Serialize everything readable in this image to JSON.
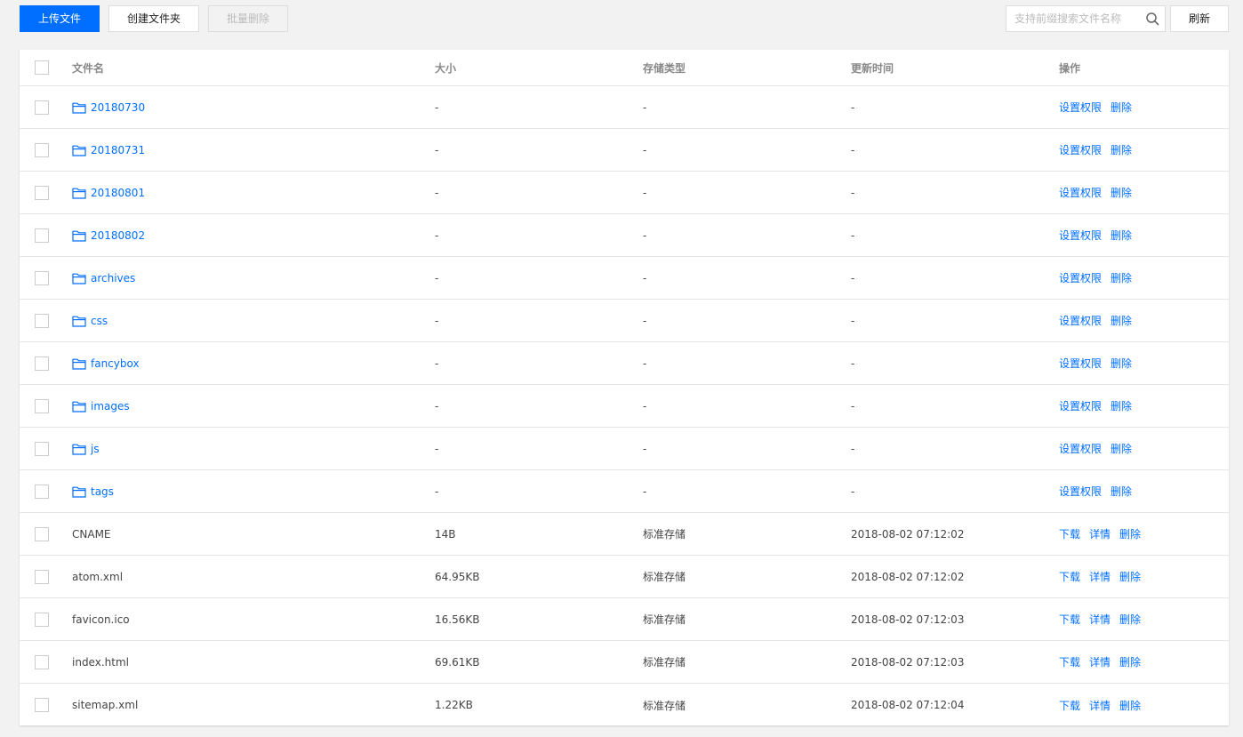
{
  "toolbar": {
    "upload_label": "上传文件",
    "mkdir_label": "创建文件夹",
    "batch_delete_label": "批量删除",
    "refresh_label": "刷新",
    "search_placeholder": "支持前缀搜索文件名称"
  },
  "colors": {
    "accent": "#006eff",
    "background": "#f2f2f2",
    "panel": "#ffffff"
  },
  "table": {
    "columns": {
      "name": "文件名",
      "size": "大小",
      "storage": "存储类型",
      "updated": "更新时间",
      "actions": "操作"
    },
    "folder_actions": [
      "设置权限",
      "删除"
    ],
    "file_actions": [
      "下载",
      "详情",
      "删除"
    ],
    "rows": [
      {
        "type": "folder",
        "name": "20180730",
        "size": "-",
        "storage": "-",
        "updated": "-"
      },
      {
        "type": "folder",
        "name": "20180731",
        "size": "-",
        "storage": "-",
        "updated": "-"
      },
      {
        "type": "folder",
        "name": "20180801",
        "size": "-",
        "storage": "-",
        "updated": "-"
      },
      {
        "type": "folder",
        "name": "20180802",
        "size": "-",
        "storage": "-",
        "updated": "-"
      },
      {
        "type": "folder",
        "name": "archives",
        "size": "-",
        "storage": "-",
        "updated": "-"
      },
      {
        "type": "folder",
        "name": "css",
        "size": "-",
        "storage": "-",
        "updated": "-"
      },
      {
        "type": "folder",
        "name": "fancybox",
        "size": "-",
        "storage": "-",
        "updated": "-"
      },
      {
        "type": "folder",
        "name": "images",
        "size": "-",
        "storage": "-",
        "updated": "-"
      },
      {
        "type": "folder",
        "name": "js",
        "size": "-",
        "storage": "-",
        "updated": "-"
      },
      {
        "type": "folder",
        "name": "tags",
        "size": "-",
        "storage": "-",
        "updated": "-"
      },
      {
        "type": "file",
        "name": "CNAME",
        "size": "14B",
        "storage": "标准存储",
        "updated": "2018-08-02 07:12:02"
      },
      {
        "type": "file",
        "name": "atom.xml",
        "size": "64.95KB",
        "storage": "标准存储",
        "updated": "2018-08-02 07:12:02"
      },
      {
        "type": "file",
        "name": "favicon.ico",
        "size": "16.56KB",
        "storage": "标准存储",
        "updated": "2018-08-02 07:12:03"
      },
      {
        "type": "file",
        "name": "index.html",
        "size": "69.61KB",
        "storage": "标准存储",
        "updated": "2018-08-02 07:12:03"
      },
      {
        "type": "file",
        "name": "sitemap.xml",
        "size": "1.22KB",
        "storage": "标准存储",
        "updated": "2018-08-02 07:12:04"
      }
    ]
  }
}
